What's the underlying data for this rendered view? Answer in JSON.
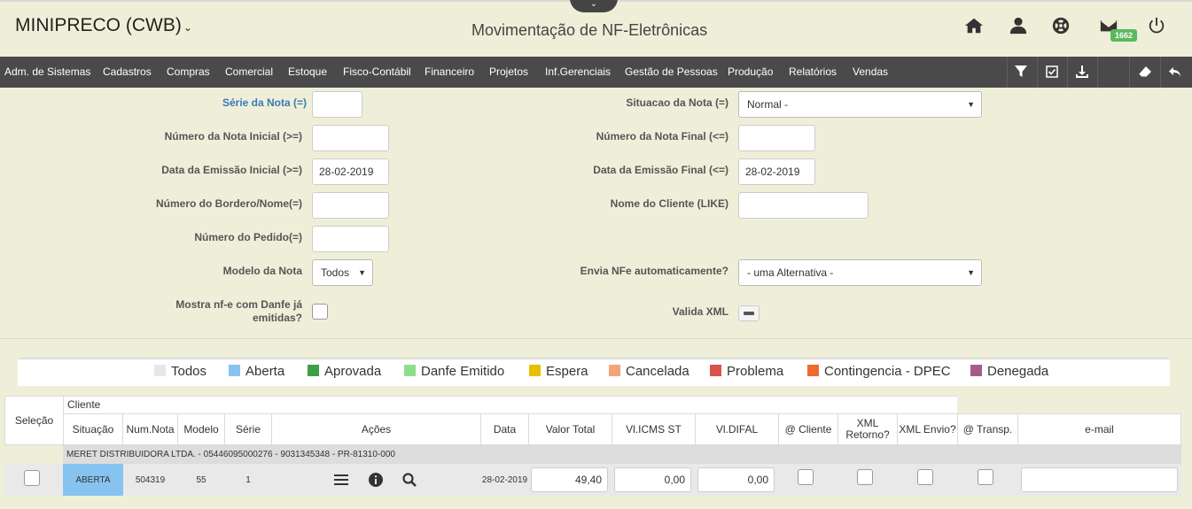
{
  "header": {
    "brand": "MINIPRECO (CWB)",
    "title": "Movimentação de NF-Eletrônicas",
    "mail_count": "1662"
  },
  "menu": [
    "Adm. de Sistemas",
    "Cadastros",
    "Compras",
    "Comercial",
    "Estoque",
    "Fisco-Contábil",
    "Financeiro",
    "Projetos",
    "Inf.Gerenciais",
    "Gestão de Pessoas",
    "Produção",
    "Relatórios",
    "Vendas"
  ],
  "form": {
    "serie_label": "Série da Nota (=)",
    "numero_inicial_label": "Número da Nota Inicial (>=)",
    "data_inicial_label": "Data da Emissão Inicial (>=)",
    "data_inicial_value": "28-02-2019",
    "bordero_label": "Número do Bordero/Nome(=)",
    "pedido_label": "Número do Pedido(=)",
    "modelo_label": "Modelo da Nota",
    "modelo_value": "Todos",
    "danfe_label": "Mostra nf-e com Danfe já emitidas?",
    "situacao_label": "Situacao da Nota (=)",
    "situacao_value": "Normal -",
    "numero_final_label": "Número da Nota Final (<=)",
    "data_final_label": "Data da Emissão Final (<=)",
    "data_final_value": "28-02-2019",
    "cliente_label": "Nome do Cliente (LIKE)",
    "envia_label": "Envia NFe automaticamente?",
    "envia_value": "- uma Alternativa -",
    "valida_label": "Valida XML"
  },
  "legend": [
    {
      "label": "Todos",
      "color": "#e6e6ec"
    },
    {
      "label": "Aberta",
      "color": "#87c3f0"
    },
    {
      "label": "Aprovada",
      "color": "#3f9f48"
    },
    {
      "label": "Danfe Emitido",
      "color": "#8fdc8f"
    },
    {
      "label": "Espera",
      "color": "#e8c000"
    },
    {
      "label": "Cancelada",
      "color": "#f2a47a"
    },
    {
      "label": "Problema",
      "color": "#d9534f"
    },
    {
      "label": "Contingencia - DPEC",
      "color": "#f06a30"
    },
    {
      "label": "Denegada",
      "color": "#a35c8a"
    }
  ],
  "table": {
    "selecao": "Seleção",
    "cliente": "Cliente",
    "headers": [
      "Situação",
      "Num.Nota",
      "Modelo",
      "Série",
      "Ações",
      "Data",
      "Valor Total",
      "Vl.ICMS ST",
      "Vl.DIFAL",
      "@ Cliente",
      "XML Retorno?",
      "XML Envio?",
      "@ Transp.",
      "e-mail"
    ],
    "group": "MERET DISTRIBUIDORA LTDA. - 05446095000276 - 9031345348 - PR-81310-000",
    "row": {
      "situacao": "ABERTA",
      "situacao_color": "#87c3f0",
      "num": "504319",
      "modelo": "55",
      "serie": "1",
      "data": "28-02-2019",
      "valor": "49,40",
      "icms": "0,00",
      "difal": "0,00"
    }
  }
}
